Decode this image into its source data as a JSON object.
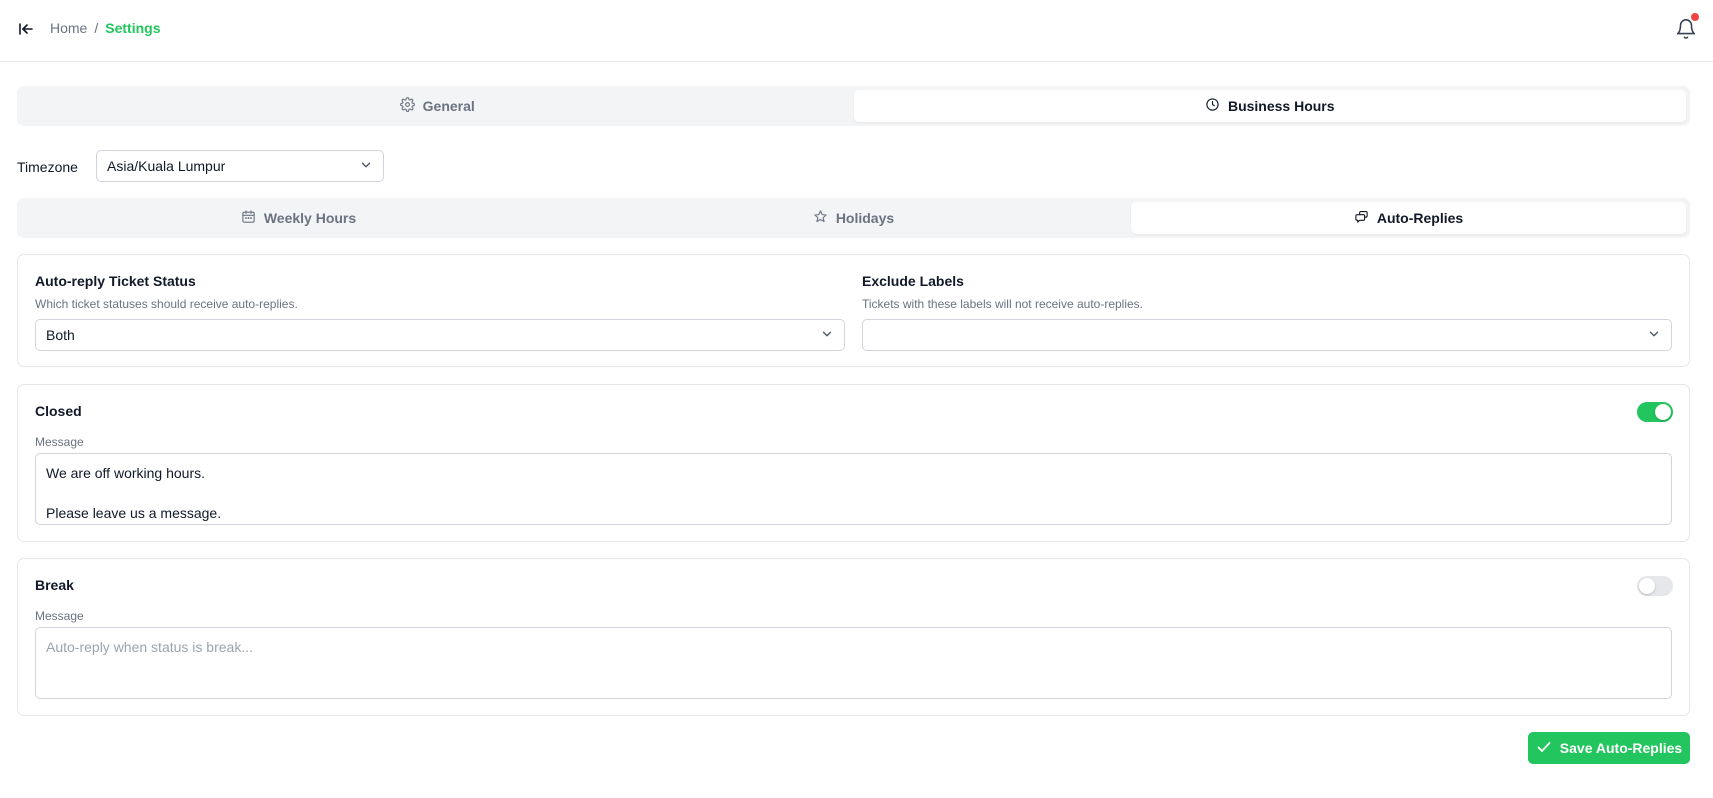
{
  "header": {
    "collapse_icon": "panel-collapse-icon",
    "breadcrumb": {
      "home": "Home",
      "separator": "/",
      "current": "Settings"
    },
    "notification_icon": "bell-icon",
    "has_unread": true
  },
  "main_tabs": [
    {
      "label": "General",
      "icon": "gear-icon",
      "active": false
    },
    {
      "label": "Business Hours",
      "icon": "clock-icon",
      "active": true
    }
  ],
  "timezone": {
    "label": "Timezone",
    "value": "Asia/Kuala Lumpur"
  },
  "sub_tabs": [
    {
      "label": "Weekly Hours",
      "icon": "calendar-icon",
      "active": false
    },
    {
      "label": "Holidays",
      "icon": "star-icon",
      "active": false
    },
    {
      "label": "Auto-Replies",
      "icon": "chat-bubbles-icon",
      "active": true
    }
  ],
  "settings": {
    "status": {
      "title": "Auto-reply Ticket Status",
      "description": "Which ticket statuses should receive auto-replies.",
      "value": "Both"
    },
    "exclude": {
      "title": "Exclude Labels",
      "description": "Tickets with these labels will not receive auto-replies.",
      "value": ""
    }
  },
  "closed": {
    "title": "Closed",
    "enabled": true,
    "message_label": "Message",
    "message": "We are off working hours.\n\nPlease leave us a message."
  },
  "break": {
    "title": "Break",
    "enabled": false,
    "message_label": "Message",
    "placeholder": "Auto-reply when status is break...",
    "message": ""
  },
  "save_button": {
    "label": "Save Auto-Replies",
    "icon": "check-icon"
  },
  "colors": {
    "accent": "#22c55e",
    "notification": "#ef4444",
    "muted_text": "#6b7280"
  }
}
